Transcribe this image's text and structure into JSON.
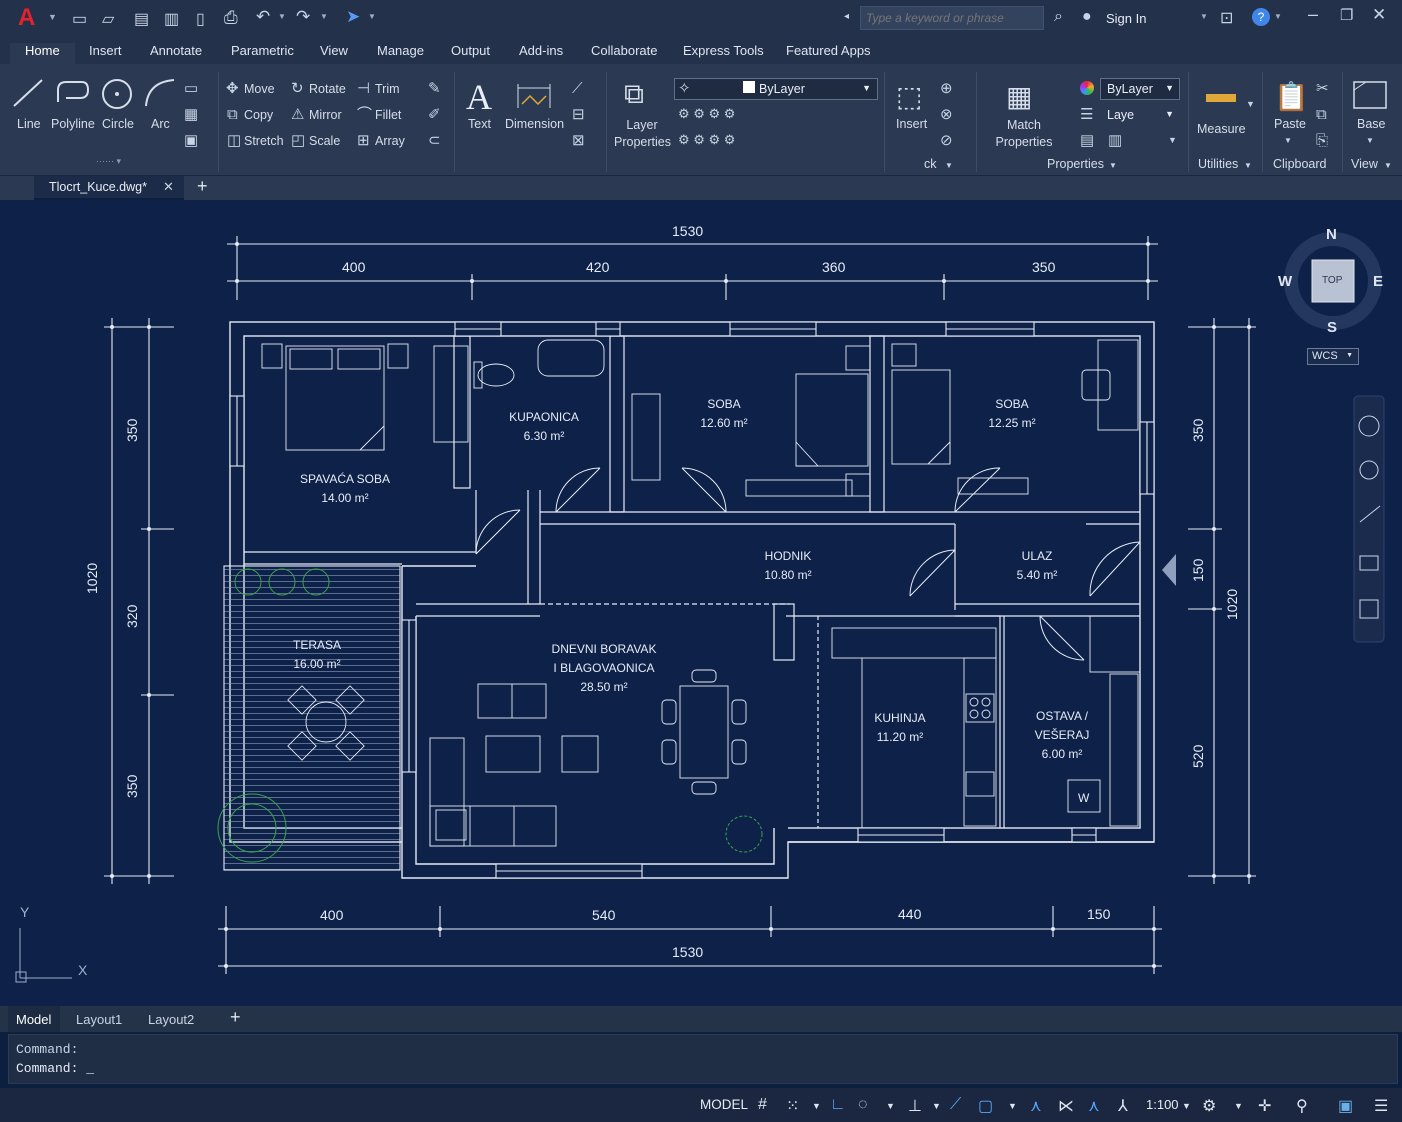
{
  "app": {
    "logo": "A",
    "search_placeholder": "Type a keyword or phrase",
    "sign_in": "Sign In"
  },
  "menu": [
    "Home",
    "Insert",
    "Annotate",
    "Parametric",
    "View",
    "Manage",
    "Output",
    "Add-ins",
    "Collaborate",
    "Express Tools",
    "Featured Apps"
  ],
  "ribbon": {
    "draw": [
      "Line",
      "Polyline",
      "Circle",
      "Arc"
    ],
    "modify": [
      "Move",
      "Rotate",
      "Trim",
      "Copy",
      "Mirror",
      "Fillet",
      "Stretch",
      "Scale",
      "Array"
    ],
    "annotation": [
      "Text",
      "Dimension"
    ],
    "layer_properties": "Layer Properties",
    "bylayer_label": "ByLayer",
    "insert": "Insert",
    "match_properties": "Match Properties",
    "props_bylayer": "ByLayer",
    "props_layer": "Laye",
    "measure": "Measure",
    "paste": "Paste",
    "base": "Base",
    "panels": {
      "block": "ck",
      "properties": "Properties",
      "utilities": "Utilities",
      "clipboard": "Clipboard",
      "view": "View"
    }
  },
  "document_tab": "Tlocrt_Kuce.dwg*",
  "viewcube": {
    "n": "N",
    "s": "S",
    "e": "E",
    "w": "W",
    "top": "TOP",
    "wcs": "WCS"
  },
  "drawing": {
    "dims_top": {
      "total": "1530",
      "parts": [
        "400",
        "420",
        "360",
        "350"
      ]
    },
    "dims_bottom": {
      "total": "1530",
      "parts": [
        "400",
        "540",
        "440",
        "150"
      ]
    },
    "dims_left": {
      "total": "1020",
      "parts": [
        "350",
        "320",
        "350"
      ]
    },
    "dims_right": {
      "total": "1020",
      "parts": [
        "350",
        "150",
        "520"
      ]
    },
    "rooms": [
      {
        "name": "SPAVAĆA SOBA",
        "area": "14.00 m²"
      },
      {
        "name": "KUPAONICA",
        "area": "6.30 m²"
      },
      {
        "name": "SOBA",
        "area": "12.60 m²"
      },
      {
        "name": "SOBA",
        "area": "12.25 m²"
      },
      {
        "name": "HODNIK",
        "area": "10.80 m²"
      },
      {
        "name": "ULAZ",
        "area": "5.40 m²"
      },
      {
        "name": "TERASA",
        "area": "16.00 m²"
      },
      {
        "name": "DNEVNI BORAVAK",
        "name2": "I BLAGOVAONICA",
        "area": "28.50 m²"
      },
      {
        "name": "KUHINJA",
        "area": "11.20 m²"
      },
      {
        "name": "OSTAVA /",
        "name2": "VEŠERAJ",
        "area": "6.00 m²"
      }
    ],
    "washer_label": "W",
    "ucs": {
      "x": "X",
      "y": "Y"
    }
  },
  "layouts": [
    "Model",
    "Layout1",
    "Layout2"
  ],
  "command_lines": [
    "Command:",
    "Command: _"
  ],
  "status": {
    "model": "MODEL",
    "scale": "1:100"
  },
  "colors": {
    "background": "#0e2149",
    "lines": "#e6ecf5",
    "plants": "#3aa34a"
  }
}
